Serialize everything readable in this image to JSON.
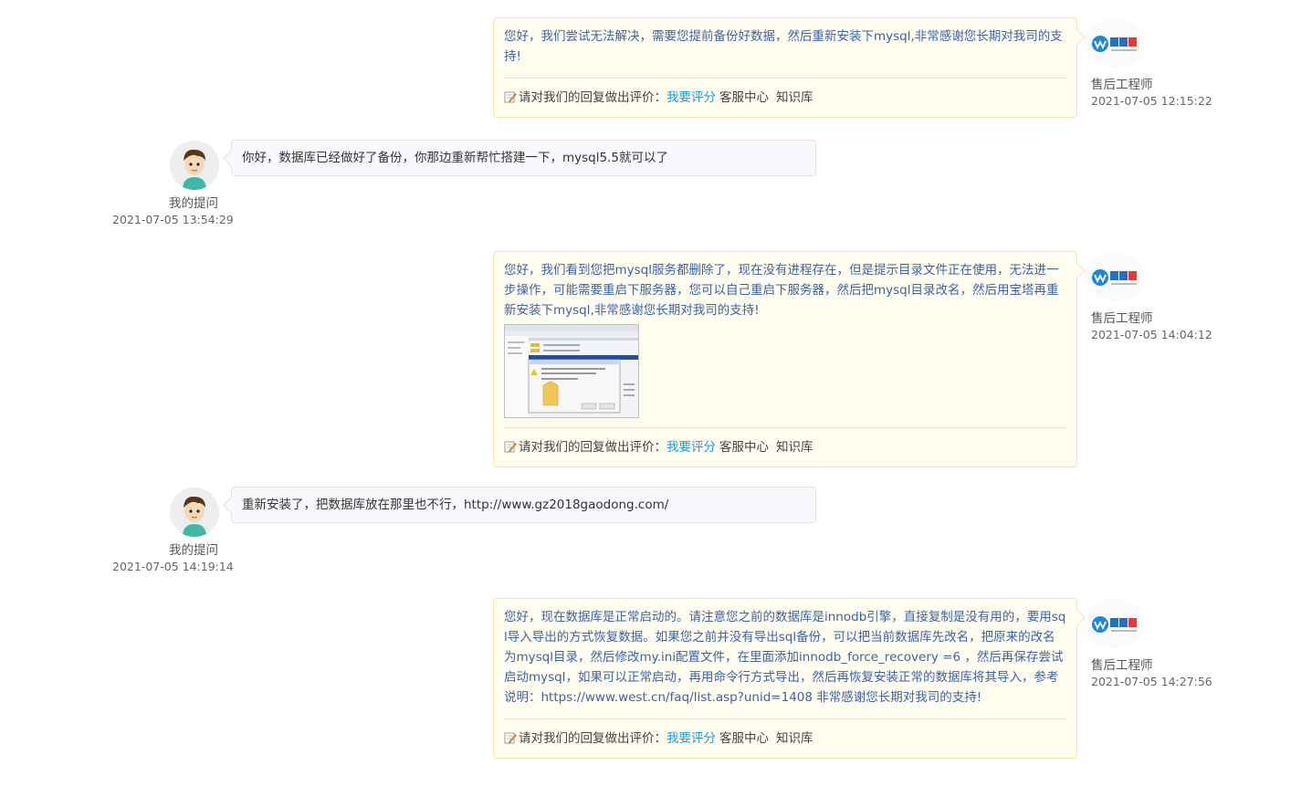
{
  "rating": {
    "prompt": "请对我们的回复做出评价：",
    "rate_link": "我要评分",
    "service_center": "客服中心",
    "knowledge_base": "知识库"
  },
  "staff_label": "售后工程师",
  "user_label": "我的提问",
  "messages": [
    {
      "role": "staff",
      "text": "您好，我们尝试无法解决，需要您提前备份好数据，然后重新安装下mysql,非常感谢您长期对我司的支持!",
      "time": "2021-07-05 12:15:22"
    },
    {
      "role": "user",
      "text": "你好，数据库已经做好了备份，你那边重新帮忙搭建一下，mysql5.5就可以了",
      "time": "2021-07-05 13:54:29"
    },
    {
      "role": "staff",
      "text": "您好，我们看到您把mysql服务都删除了，现在没有进程存在，但是提示目录文件正在使用，无法进一步操作，可能需要重启下服务器，您可以自己重启下服务器，然后把mysql目录改名，然后用宝塔再重新安装下mysql,非常感谢您长期对我司的支持!",
      "time": "2021-07-05 14:04:12"
    },
    {
      "role": "user",
      "text": "重新安装了，把数据库放在那里也不行，http://www.gz2018gaodong.com/",
      "time": "2021-07-05 14:19:14"
    },
    {
      "role": "staff",
      "text": "您好，现在数据库是正常启动的。请注意您之前的数据库是innodb引擎，直接复制是没有用的，要用sql导入导出的方式恢复数据。如果您之前并没有导出sql备份，可以把当前数据库先改名，把原来的改名为mysql目录，然后修改my.ini配置文件，在里面添加innodb_force_recovery =6 ，然后再保存尝试启动mysql，如果可以正常启动，再用命令行方式导出，然后再恢复安装正常的数据库将其导入，参考说明：https://www.west.cn/faq/list.asp?unid=1408 非常感谢您长期对我司的支持!",
      "time": "2021-07-05 14:27:56"
    }
  ],
  "icons": {
    "staff_avatar": "west-cn-logo-icon",
    "user_avatar": "user-avatar-icon",
    "rate": "edit-note-icon"
  },
  "colors": {
    "staff_text": "#3d63a8",
    "link": "#1f9ad6",
    "staff_bubble_bg": "#fffdf0",
    "user_bubble_bg": "#f8f9fc"
  }
}
